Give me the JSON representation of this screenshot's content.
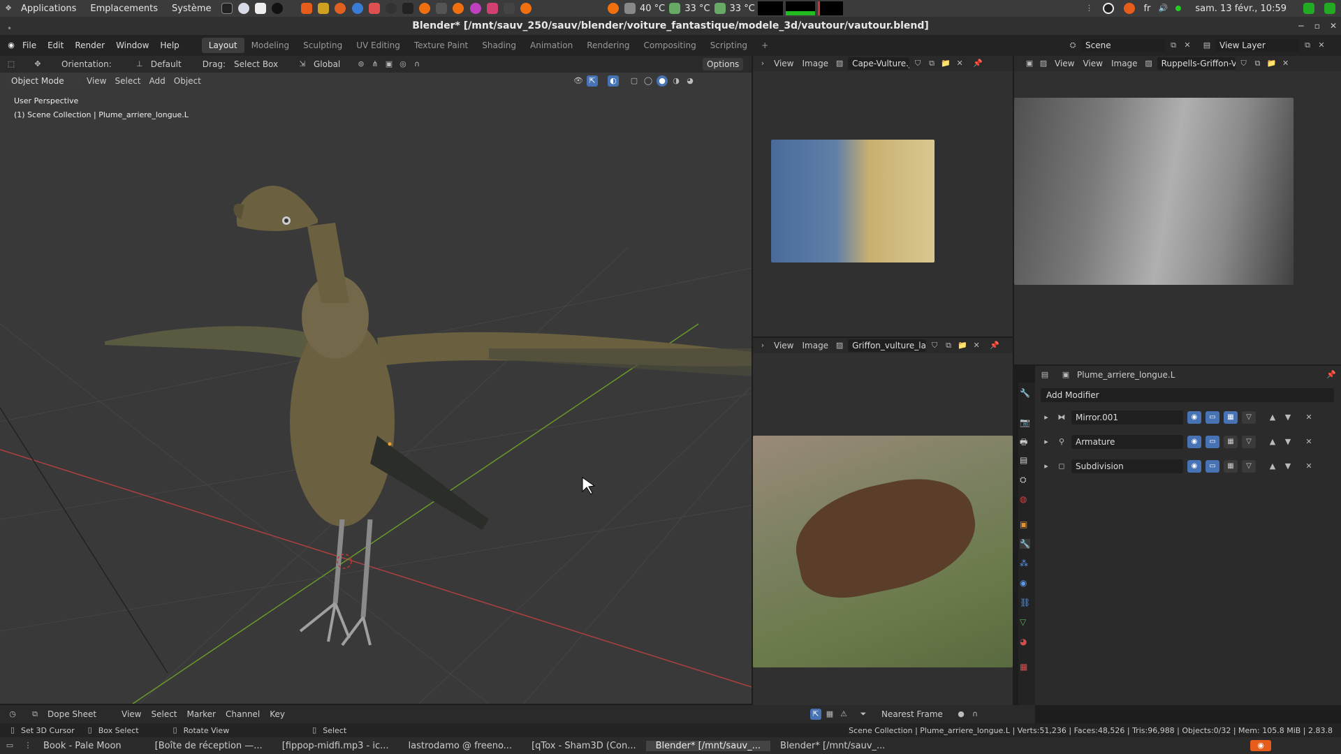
{
  "os_bar": {
    "applications": "Applications",
    "places": "Emplacements",
    "system": "Système",
    "temp1": "40 °C",
    "temp2": "33 °C",
    "temp3": "33 °C",
    "lang": "fr",
    "datetime": "sam. 13 févr., 10:59"
  },
  "window": {
    "title": "Blender* [/mnt/sauv_250/sauv/blender/voiture_fantastique/modele_3d/vautour/vautour.blend]"
  },
  "menu": {
    "items": [
      "File",
      "Edit",
      "Render",
      "Window",
      "Help"
    ],
    "workspaces": [
      "Layout",
      "Modeling",
      "Sculpting",
      "UV Editing",
      "Texture Paint",
      "Shading",
      "Animation",
      "Rendering",
      "Compositing",
      "Scripting"
    ],
    "active_workspace": "Layout",
    "add_ws": "+",
    "scene_label": "Scene",
    "view_layer_label": "View Layer"
  },
  "viewport_header": {
    "orientation_label": "Orientation:",
    "orientation_value": "Default",
    "drag_label": "Drag:",
    "drag_value": "Select Box",
    "transform_value": "Global",
    "options": "Options",
    "mode": "Object Mode",
    "view": "View",
    "select": "Select",
    "add": "Add",
    "object": "Object"
  },
  "viewport": {
    "perspective": "User Perspective",
    "collection": "(1) Scene Collection | Plume_arriere_longue.L"
  },
  "image_editor_1": {
    "view": "View",
    "image": "Image",
    "file": "Cape-Vulture.jpg"
  },
  "image_editor_2": {
    "view": "View",
    "image": "Image",
    "file": "Griffon_vulture_land..."
  },
  "image_editor_3": {
    "view": "View",
    "view2": "View",
    "image": "Image",
    "file": "Ruppells-Griffon-Vult..."
  },
  "properties": {
    "object": "Plume_arriere_longue.L",
    "add_modifier": "Add Modifier",
    "modifiers": [
      "Mirror.001",
      "Armature",
      "Subdivision"
    ]
  },
  "dopesheet": {
    "mode": "Dope Sheet",
    "view": "View",
    "select": "Select",
    "marker": "Marker",
    "channel": "Channel",
    "key": "Key",
    "snap": "Nearest Frame"
  },
  "status": {
    "cursor": "Set 3D Cursor",
    "box": "Box Select",
    "rotate": "Rotate View",
    "select": "Select",
    "stats": "Scene Collection | Plume_arriere_longue.L | Verts:51,236 | Faces:48,526 | Tris:96,988 | Objects:0/32 | Mem: 105.8 MiB | 2.83.8"
  },
  "taskbar": {
    "items": [
      "Book - Pale Moon",
      "[Boîte de réception —...",
      "[fippop-midfi.mp3 - ic...",
      "lastrodamo @ freeno...",
      "[qTox - Sham3D (Con...",
      "Blender* [/mnt/sauv_...",
      "Blender* [/mnt/sauv_..."
    ],
    "active": 5
  }
}
